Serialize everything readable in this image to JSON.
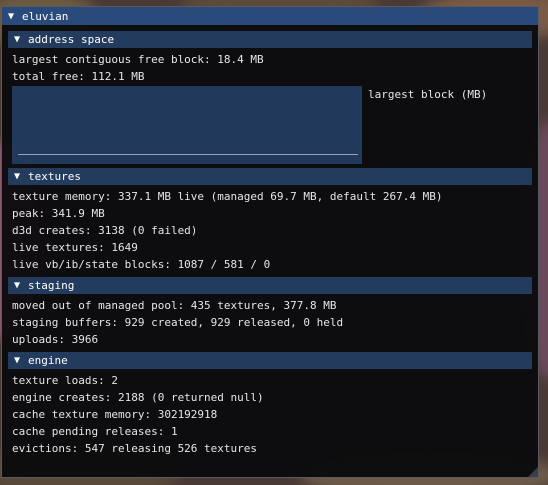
{
  "window": {
    "title": "eluvian"
  },
  "address_space": {
    "header": "address space",
    "lines": [
      "largest contiguous free block: 18.4 MB",
      "total free: 112.1 MB"
    ],
    "plot_label": "largest block (MB)"
  },
  "textures": {
    "header": "textures",
    "lines": [
      "texture memory: 337.1 MB live (managed 69.7 MB, default 267.4 MB)",
      "peak: 341.9 MB",
      "d3d creates: 3138 (0 failed)",
      "live textures: 1649",
      "live vb/ib/state blocks: 1087 / 581 / 0"
    ]
  },
  "staging": {
    "header": "staging",
    "lines": [
      "moved out of managed pool: 435 textures, 377.8 MB",
      "staging buffers: 929 created, 929 released, 0 held",
      "uploads: 3966"
    ]
  },
  "engine": {
    "header": "engine",
    "lines": [
      "texture loads: 2",
      "engine creates: 2188 (0 returned null)",
      "cache texture memory: 302192918",
      "cache pending releases: 1",
      "evictions: 547 releasing 526 textures"
    ]
  },
  "colors": {
    "title_bar": "#294a7a",
    "section_header": "#233c5e",
    "window_bg": "#0a0a0c",
    "text": "#e6e6e6"
  },
  "icons": {
    "collapse": "triangle-down-icon"
  }
}
